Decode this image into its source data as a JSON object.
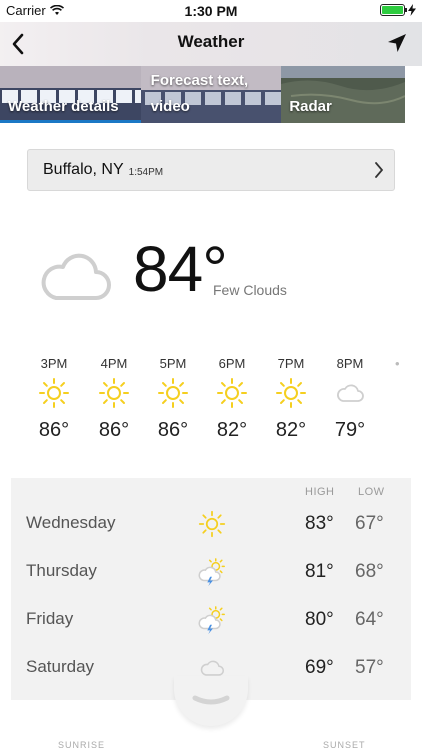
{
  "status_bar": {
    "carrier": "Carrier",
    "time": "1:30 PM"
  },
  "nav": {
    "title": "Weather",
    "back_icon": "chevron-left-icon",
    "location_icon": "location-arrow-icon"
  },
  "tabs": [
    {
      "label": "Weather details",
      "active": true
    },
    {
      "label_line1": "Forecast text,",
      "label_line2": "video",
      "active": false
    },
    {
      "label": "Radar",
      "active": false
    }
  ],
  "location": {
    "city": "Buffalo, NY",
    "updated": "1:54PM"
  },
  "current": {
    "temp": "84°",
    "condition": "Few Clouds",
    "icon": "cloud-icon"
  },
  "hourly": [
    {
      "time": "3PM",
      "temp": "86°",
      "icon": "sun-icon"
    },
    {
      "time": "4PM",
      "temp": "86°",
      "icon": "sun-icon"
    },
    {
      "time": "5PM",
      "temp": "86°",
      "icon": "sun-icon"
    },
    {
      "time": "6PM",
      "temp": "82°",
      "icon": "sun-icon"
    },
    {
      "time": "7PM",
      "temp": "82°",
      "icon": "sun-icon"
    },
    {
      "time": "8PM",
      "temp": "79°",
      "icon": "cloud-icon"
    }
  ],
  "daily": {
    "high_label": "HIGH",
    "low_label": "LOW",
    "days": [
      {
        "day": "Wednesday",
        "high": "83°",
        "low": "67°",
        "icon": "sun-icon"
      },
      {
        "day": "Thursday",
        "high": "81°",
        "low": "68°",
        "icon": "thunderstorm-sun-icon"
      },
      {
        "day": "Friday",
        "high": "80°",
        "low": "64°",
        "icon": "thunderstorm-sun-icon"
      },
      {
        "day": "Saturday",
        "high": "69°",
        "low": "57°",
        "icon": "cloud-icon"
      }
    ]
  },
  "footer": {
    "sunrise_label": "SUNRISE",
    "sunset_label": "SUNSET"
  },
  "colors": {
    "accent": "#1b78c5",
    "sun": "#f5cf1f",
    "bolt": "#4a90e2"
  }
}
